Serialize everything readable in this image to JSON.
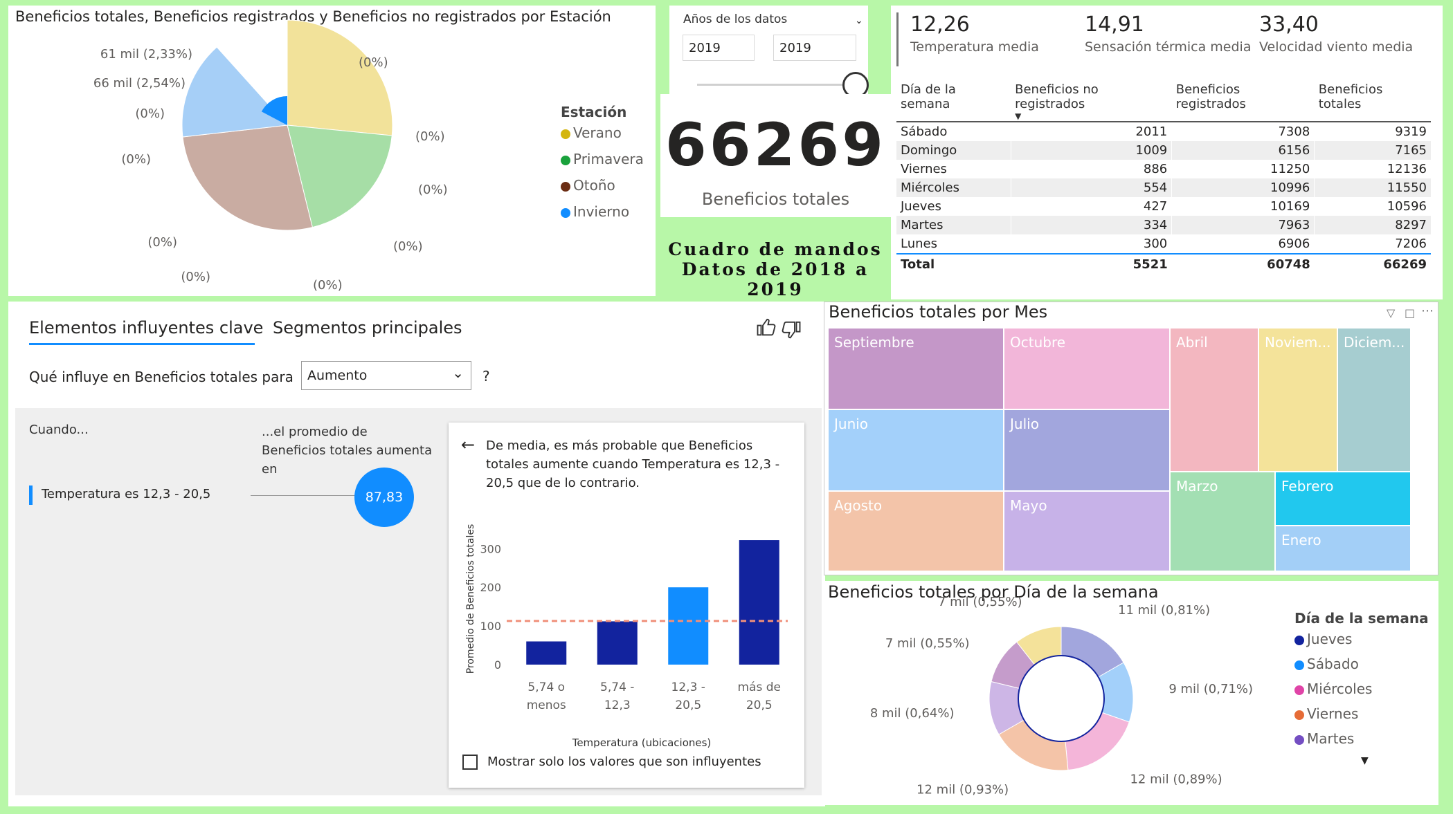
{
  "pie": {
    "title": "Beneficios totales, Beneficios registrados y Beneficios no registrados por Estación",
    "labels": [
      "61 mil (2,33%)",
      "66 mil (2,54%)",
      "(0%)",
      "(0%)",
      "(0%)",
      "(0%)",
      "(0%)",
      "(0%)",
      "(0%)",
      "(0%)",
      "(0%)"
    ],
    "legend_title": "Estación",
    "legend": [
      {
        "label": "Verano",
        "color": "#d4b60f"
      },
      {
        "label": "Primavera",
        "color": "#1aa23c"
      },
      {
        "label": "Otoño",
        "color": "#6b2d14"
      },
      {
        "label": "Invierno",
        "color": "#118dff"
      }
    ]
  },
  "slicer": {
    "title": "Años de los datos",
    "from": "2019",
    "to": "2019"
  },
  "kpi": {
    "value": "66269",
    "label": "Beneficios totales"
  },
  "banner": {
    "line1": "Cuadro de mandos",
    "line2": "Datos de 2018 a 2019"
  },
  "cards": [
    {
      "value": "12,26",
      "label": "Temperatura media"
    },
    {
      "value": "14,91",
      "label": "Sensación térmica media"
    },
    {
      "value": "33,40",
      "label": "Velocidad viento media"
    }
  ],
  "table": {
    "headers": [
      "Día de la semana",
      "Beneficios no registrados",
      "Beneficios registrados",
      "Beneficios totales"
    ],
    "rows": [
      [
        "Sábado",
        "2011",
        "7308",
        "9319"
      ],
      [
        "Domingo",
        "1009",
        "6156",
        "7165"
      ],
      [
        "Viernes",
        "886",
        "11250",
        "12136"
      ],
      [
        "Miércoles",
        "554",
        "10996",
        "11550"
      ],
      [
        "Jueves",
        "427",
        "10169",
        "10596"
      ],
      [
        "Martes",
        "334",
        "7963",
        "8297"
      ],
      [
        "Lunes",
        "300",
        "6906",
        "7206"
      ]
    ],
    "total": [
      "Total",
      "5521",
      "60748",
      "66269"
    ]
  },
  "influencers": {
    "tab_active": "Elementos influyentes clave",
    "tab_other": "Segmentos principales",
    "question": "Qué influye en Beneficios totales para",
    "dropdown": "Aumento",
    "help": "?",
    "when": "Cuando...",
    "then": "...el promedio de Beneficios totales aumenta en",
    "factor": "Temperatura es 12,3 - 20,5",
    "bubble": "87,83",
    "detail_text": "De media, es más probable que Beneficios totales aumente cuando Temperatura es 12,3 - 20,5 que de lo contrario.",
    "checkbox_label": "Mostrar solo los valores que son influyentes"
  },
  "chart_data": [
    {
      "type": "bar",
      "categories": [
        "5,74 o menos",
        "5,74 - 12,3",
        "12,3 - 20,5",
        "más de 20,5"
      ],
      "values": [
        60,
        112,
        200,
        322
      ],
      "highlight": [
        false,
        false,
        true,
        false
      ],
      "average_line": 113,
      "ylabel": "Promedio de Beneficios totales",
      "xlabel": "Temperatura (ubicaciones)",
      "yticks": [
        "0",
        "100",
        "200",
        "300"
      ],
      "ylim": [
        0,
        340
      ],
      "colors": {
        "bar": "#12239e",
        "highlight": "#118dff",
        "avg": "#f0907a"
      }
    },
    {
      "type": "treemap",
      "title": "Beneficios totales por Mes",
      "items": [
        {
          "label": "Septiembre",
          "color": "#c497c8"
        },
        {
          "label": "Octubre",
          "color": "#f2b6d9"
        },
        {
          "label": "Abril",
          "color": "#f3b7c0"
        },
        {
          "label": "Noviem...",
          "color": "#f4e39a"
        },
        {
          "label": "Diciem...",
          "color": "#a6cdd0"
        },
        {
          "label": "Junio",
          "color": "#a3d0fa"
        },
        {
          "label": "Julio",
          "color": "#a2a6dd"
        },
        {
          "label": "Marzo",
          "color": "#a3dfb3"
        },
        {
          "label": "Febrero",
          "color": "#21c8ee"
        },
        {
          "label": "Enero",
          "color": "#a3cff7"
        },
        {
          "label": "Agosto",
          "color": "#f3c4a9"
        },
        {
          "label": "Mayo",
          "color": "#c7b2e8"
        }
      ]
    },
    {
      "type": "pie",
      "title": "Beneficios totales por Día de la semana",
      "slices": [
        {
          "label": "11 mil (0,81%)",
          "value": 11,
          "color": "#a2a6dd"
        },
        {
          "label": "9 mil (0,71%)",
          "value": 9,
          "color": "#a3d0fa"
        },
        {
          "label": "12 mil (0,89%)",
          "value": 12,
          "color": "#f4b5d9"
        },
        {
          "label": "12 mil (0,93%)",
          "value": 12,
          "color": "#f4c4a8"
        },
        {
          "label": "8 mil (0,64%)",
          "value": 8,
          "color": "#cdb6e6"
        },
        {
          "label": "7 mil (0,55%)",
          "value": 7,
          "color": "#c59ccb"
        },
        {
          "label": "7 mil (0,55%)",
          "value": 7,
          "color": "#f4e29a"
        }
      ],
      "legend_title": "Día de la semana",
      "legend": [
        {
          "label": "Jueves",
          "color": "#12239e"
        },
        {
          "label": "Sábado",
          "color": "#118dff"
        },
        {
          "label": "Miércoles",
          "color": "#e044a7"
        },
        {
          "label": "Viernes",
          "color": "#e66c37"
        },
        {
          "label": "Martes",
          "color": "#744ec2"
        }
      ]
    }
  ]
}
